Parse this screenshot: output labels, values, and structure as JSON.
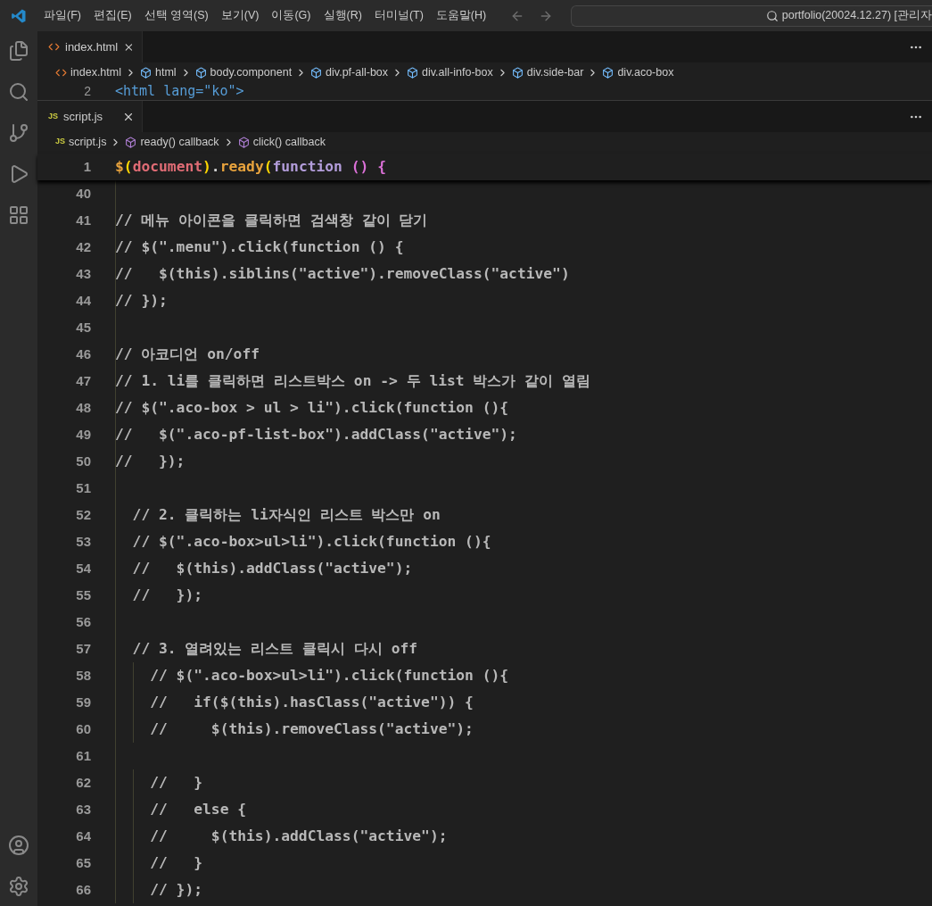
{
  "menu": [
    "파일(F)",
    "편집(E)",
    "선택 영역(S)",
    "보기(V)",
    "이동(G)",
    "실행(R)",
    "터미널(T)",
    "도움말(H)"
  ],
  "title": "portfolio(20024.12.27) [관리자",
  "editors": [
    {
      "tab": {
        "label": "index.html",
        "kind": "html"
      },
      "breadcrumbs": [
        {
          "label": "index.html",
          "kind": "html"
        },
        {
          "label": "html",
          "kind": "element"
        },
        {
          "label": "body.component",
          "kind": "element"
        },
        {
          "label": "div.pf-all-box",
          "kind": "element"
        },
        {
          "label": "div.all-info-box",
          "kind": "element"
        },
        {
          "label": "div.side-bar",
          "kind": "element"
        },
        {
          "label": "div.aco-box",
          "kind": "element"
        }
      ],
      "lines": [
        {
          "number": "2",
          "tokens": [
            {
              "text": "<html lang=\"ko\">",
              "kind": "tag"
            }
          ]
        }
      ]
    },
    {
      "tab": {
        "label": "script.js",
        "kind": "js",
        "icon": "JS"
      },
      "breadcrumbs": [
        {
          "label": "script.js",
          "kind": "js",
          "icon": "JS"
        },
        {
          "label": "ready() callback",
          "kind": "function"
        },
        {
          "label": "click() callback",
          "kind": "function"
        }
      ],
      "lines": [
        {
          "number": "1",
          "sticky": true,
          "tokens": [
            {
              "text": "$",
              "kind": "dollar"
            },
            {
              "text": "(",
              "kind": "bracket1"
            },
            {
              "text": "document",
              "kind": "variable"
            },
            {
              "text": ")",
              "kind": "bracket1"
            },
            {
              "text": ".",
              "kind": "plain"
            },
            {
              "text": "ready",
              "kind": "method"
            },
            {
              "text": "(",
              "kind": "bracket1"
            },
            {
              "text": "function",
              "kind": "keyword"
            },
            {
              "text": " ()",
              "kind": "bracket2"
            },
            {
              "text": " {",
              "kind": "bracket2"
            }
          ]
        },
        {
          "number": "40",
          "sticky": false
        },
        {
          "number": "41",
          "sticky": false,
          "tokens": [
            {
              "text": "// 메뉴 아이콘을 클릭하면 검색창 같이 닫기",
              "kind": "comment"
            }
          ]
        },
        {
          "number": "42",
          "sticky": false,
          "tokens": [
            {
              "text": "// $(\".menu\").click(function () {",
              "kind": "comment"
            }
          ]
        },
        {
          "number": "43",
          "sticky": false,
          "tokens": [
            {
              "text": "//   $(this).siblins(\"active\").removeClass(\"active\")",
              "kind": "comment"
            }
          ]
        },
        {
          "number": "44",
          "sticky": false,
          "tokens": [
            {
              "text": "// });",
              "kind": "comment"
            }
          ]
        },
        {
          "number": "45",
          "sticky": false
        },
        {
          "number": "46",
          "sticky": false,
          "tokens": [
            {
              "text": "// 아코디언 on/off",
              "kind": "comment"
            }
          ]
        },
        {
          "number": "47",
          "sticky": false,
          "tokens": [
            {
              "text": "// 1. li를 클릭하면 리스트박스 on -> 두 list 박스가 같이 열림",
              "kind": "comment"
            }
          ]
        },
        {
          "number": "48",
          "sticky": false,
          "tokens": [
            {
              "text": "// $(\".aco-box > ul > li\").click(function (){",
              "kind": "comment"
            }
          ]
        },
        {
          "number": "49",
          "sticky": false,
          "tokens": [
            {
              "text": "//   $(\".aco-pf-list-box\").addClass(\"active\");",
              "kind": "comment"
            }
          ]
        },
        {
          "number": "50",
          "sticky": false,
          "tokens": [
            {
              "text": "//   });",
              "kind": "comment"
            }
          ]
        },
        {
          "number": "51",
          "sticky": false
        },
        {
          "number": "52",
          "sticky": false,
          "tokens": [
            {
              "text": "  // 2. 클릭하는 li자식인 리스트 박스만 on",
              "kind": "comment"
            }
          ]
        },
        {
          "number": "53",
          "sticky": false,
          "tokens": [
            {
              "text": "  // $(\".aco-box>ul>li\").click(function (){",
              "kind": "comment"
            }
          ]
        },
        {
          "number": "54",
          "sticky": false,
          "tokens": [
            {
              "text": "  //   $(this).addClass(\"active\");",
              "kind": "comment"
            }
          ]
        },
        {
          "number": "55",
          "sticky": false,
          "tokens": [
            {
              "text": "  //   });",
              "kind": "comment"
            }
          ]
        },
        {
          "number": "56",
          "sticky": false
        },
        {
          "number": "57",
          "sticky": false,
          "tokens": [
            {
              "text": "  // 3. 열려있는 리스트 클릭시 다시 off",
              "kind": "comment"
            }
          ]
        },
        {
          "number": "58",
          "sticky": false,
          "tokens": [
            {
              "text": "    // $(\".aco-box>ul>li\").click(function (){",
              "kind": "comment"
            }
          ]
        },
        {
          "number": "59",
          "sticky": false,
          "tokens": [
            {
              "text": "    //   if($(this).hasClass(\"active\")) {",
              "kind": "comment"
            }
          ]
        },
        {
          "number": "60",
          "sticky": false,
          "tokens": [
            {
              "text": "    //     $(this).removeClass(\"active\");",
              "kind": "comment"
            }
          ]
        },
        {
          "number": "61",
          "sticky": false
        },
        {
          "number": "62",
          "sticky": false,
          "tokens": [
            {
              "text": "    //   }",
              "kind": "comment"
            }
          ]
        },
        {
          "number": "63",
          "sticky": false,
          "tokens": [
            {
              "text": "    //   else {",
              "kind": "comment"
            }
          ]
        },
        {
          "number": "64",
          "sticky": false,
          "tokens": [
            {
              "text": "    //     $(this).addClass(\"active\");",
              "kind": "comment"
            }
          ]
        },
        {
          "number": "65",
          "sticky": false,
          "tokens": [
            {
              "text": "    //   }",
              "kind": "comment"
            }
          ]
        },
        {
          "number": "66",
          "sticky": false,
          "tokens": [
            {
              "text": "    // });",
              "kind": "comment"
            }
          ]
        }
      ]
    }
  ]
}
